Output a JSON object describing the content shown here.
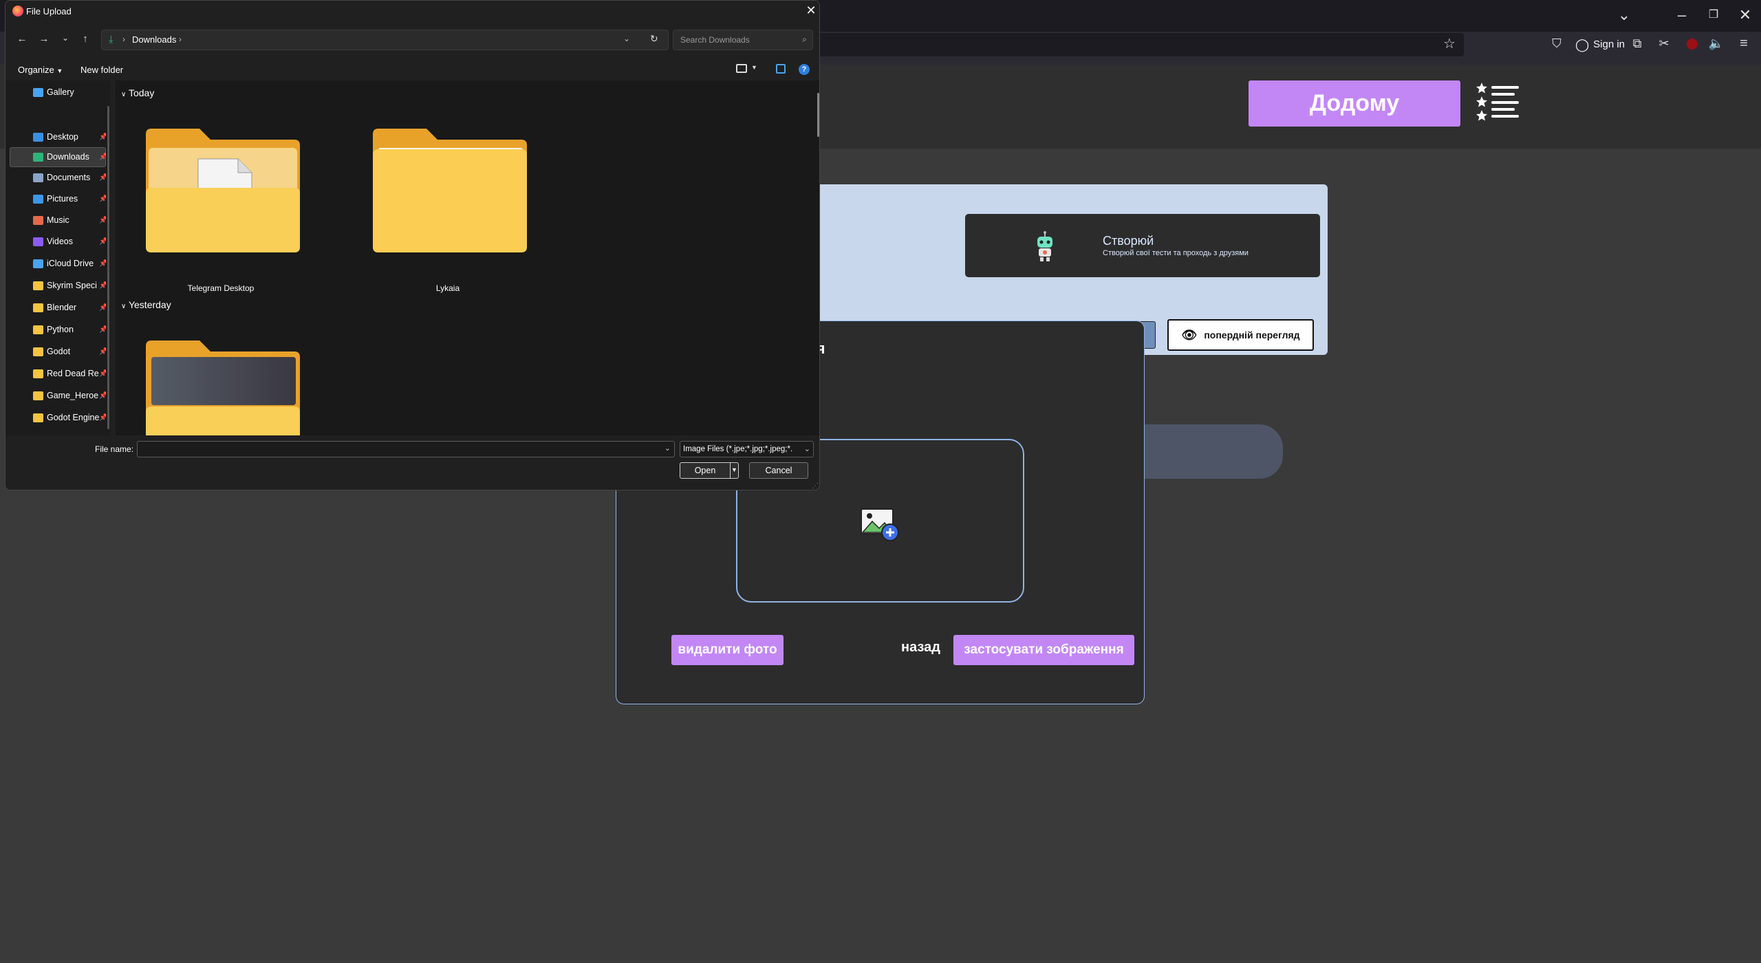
{
  "browser": {
    "sign_in": "Sign in"
  },
  "site": {
    "home_button": "Додому",
    "create_card": {
      "title": "Створюй",
      "subtitle": "Створюй свої тести та проходь з друзями"
    },
    "preview_button": "попердній перегляд",
    "modal": {
      "title_partial": "ння",
      "delete_button": "видалити фото",
      "back_button": "назад",
      "apply_button": "застосувати зображення"
    }
  },
  "dialog": {
    "title": "File Upload",
    "address": "Downloads",
    "search_placeholder": "Search Downloads",
    "organize": "Organize",
    "new_folder": "New folder",
    "sidebar": [
      {
        "label": "Gallery",
        "icon": "gallery-icon",
        "color": "#4aa3f0"
      },
      {
        "label": "Desktop",
        "icon": "desktop-icon",
        "color": "#3b8fe0"
      },
      {
        "label": "Downloads",
        "icon": "download-icon",
        "color": "#2fb37a"
      },
      {
        "label": "Documents",
        "icon": "documents-icon",
        "color": "#8aa4c8"
      },
      {
        "label": "Pictures",
        "icon": "pictures-icon",
        "color": "#3d96e8"
      },
      {
        "label": "Music",
        "icon": "music-icon",
        "color": "#e46a4c"
      },
      {
        "label": "Videos",
        "icon": "videos-icon",
        "color": "#8a5cf0"
      },
      {
        "label": "iCloud Drive",
        "icon": "icloud-icon",
        "color": "#4aa3f0"
      },
      {
        "label": "Skyrim Speci",
        "icon": "folder-icon",
        "color": "#f6c343"
      },
      {
        "label": "Blender",
        "icon": "folder-icon",
        "color": "#f6c343"
      },
      {
        "label": "Python",
        "icon": "folder-icon",
        "color": "#f6c343"
      },
      {
        "label": "Godot",
        "icon": "folder-icon",
        "color": "#f6c343"
      },
      {
        "label": "Red Dead Re",
        "icon": "folder-icon",
        "color": "#f6c343"
      },
      {
        "label": "Game_Heroe",
        "icon": "folder-icon",
        "color": "#f6c343"
      },
      {
        "label": "Godot Engine",
        "icon": "folder-icon",
        "color": "#f6c343"
      }
    ],
    "groups": [
      {
        "header": "Today",
        "items": [
          "Telegram Desktop",
          "Lykaia"
        ]
      },
      {
        "header": "Yesterday",
        "items": [
          ""
        ]
      }
    ],
    "file_name_label": "File name:",
    "file_name_value": "",
    "file_type_filter": "Image Files (*.jpe;*.jpg;*.jpeg;*.",
    "open_button": "Open",
    "cancel_button": "Cancel"
  }
}
